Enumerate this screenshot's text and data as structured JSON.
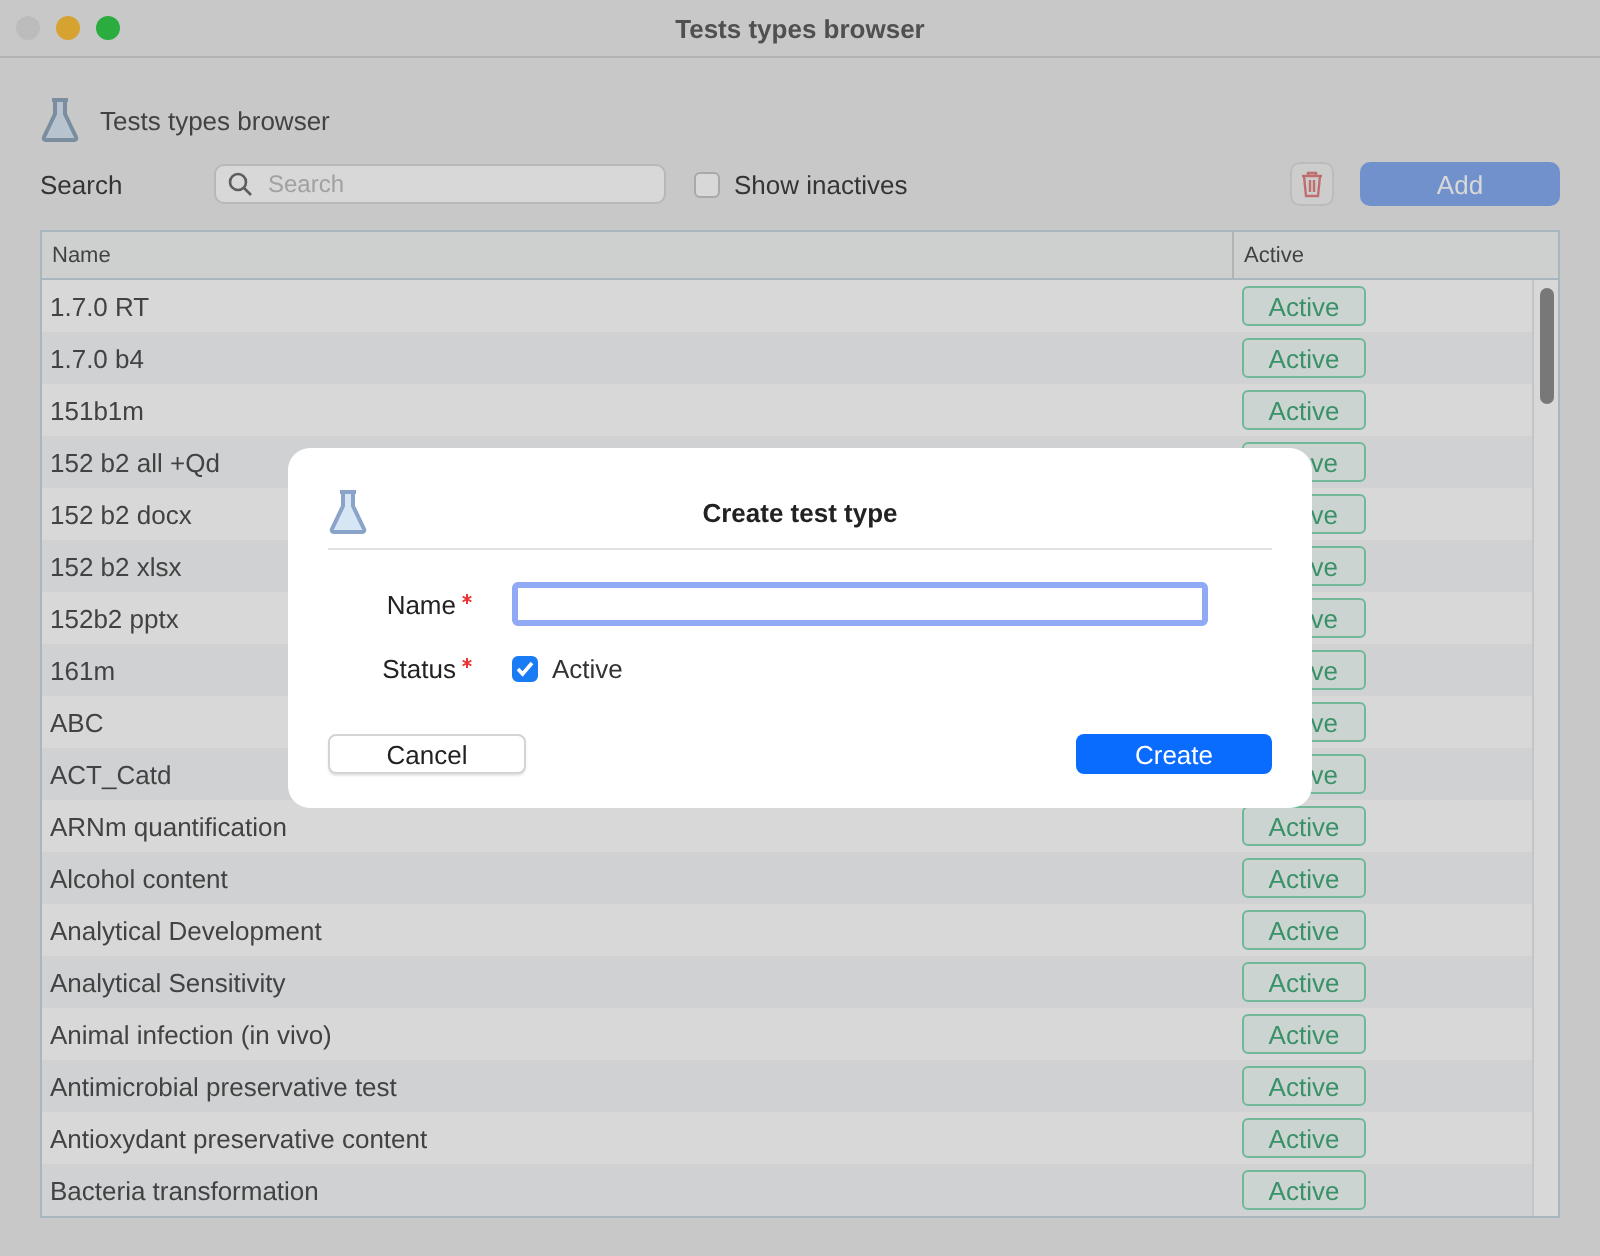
{
  "window": {
    "title": "Tests types browser"
  },
  "header": {
    "title": "Tests types browser"
  },
  "toolbar": {
    "search_label": "Search",
    "search": {
      "placeholder": "Search"
    },
    "show_inactives": {
      "label": "Show inactives",
      "checked": false
    },
    "add_button": "Add"
  },
  "table": {
    "columns": [
      "Name",
      "Active"
    ],
    "rows": [
      {
        "name": "1.7.0 RT",
        "status": "Active",
        "active": true
      },
      {
        "name": "1.7.0 b4",
        "status": "Active",
        "active": true
      },
      {
        "name": "151b1m",
        "status": "Active",
        "active": true
      },
      {
        "name": "152 b2 all +Qd",
        "status": "ve",
        "active": true,
        "clipped": true
      },
      {
        "name": "152 b2 docx",
        "status": "ve",
        "active": true,
        "clipped": true
      },
      {
        "name": "152 b2 xlsx",
        "status": "ve",
        "active": true,
        "clipped": true
      },
      {
        "name": "152b2 pptx",
        "status": "ve",
        "active": true,
        "clipped": true
      },
      {
        "name": "161m",
        "status": "ve",
        "active": true,
        "clipped": true
      },
      {
        "name": "ABC",
        "status": "ve",
        "active": true,
        "clipped": true
      },
      {
        "name": "ACT_Catd",
        "status": "ve",
        "active": true,
        "clipped": true
      },
      {
        "name": "ARNm quantification",
        "status": "Active",
        "active": true
      },
      {
        "name": "Alcohol content",
        "status": "Active",
        "active": true
      },
      {
        "name": "Analytical Development",
        "status": "Active",
        "active": true
      },
      {
        "name": "Analytical Sensitivity",
        "status": "Active",
        "active": true
      },
      {
        "name": "Animal infection (in vivo)",
        "status": "Active",
        "active": true
      },
      {
        "name": "Antimicrobial preservative test",
        "status": "Active",
        "active": true
      },
      {
        "name": "Antioxydant preservative content",
        "status": "Active",
        "active": true
      },
      {
        "name": "Bacteria transformation",
        "status": "Active",
        "active": true
      }
    ]
  },
  "dialog": {
    "title": "Create test type",
    "fields": [
      {
        "kind": "text",
        "label": "Name",
        "required": true
      },
      {
        "kind": "checkbox",
        "label": "Status",
        "required": true,
        "option": "Active",
        "checked": true
      }
    ],
    "cancel": "Cancel",
    "create": "Create"
  }
}
